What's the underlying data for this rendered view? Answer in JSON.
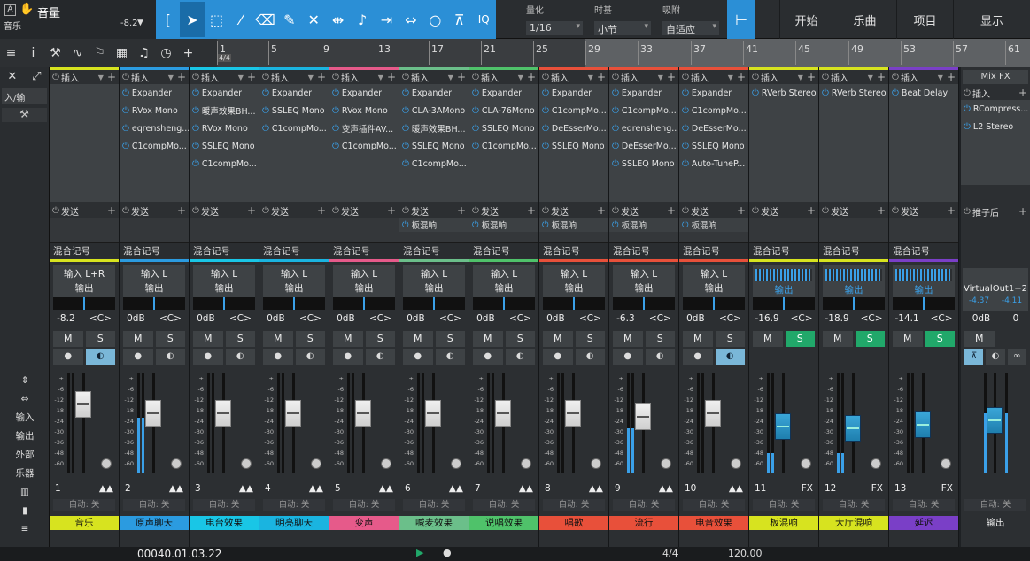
{
  "toolbar": {
    "track_icon": "A",
    "track_title": "音量",
    "track_sub": "音乐",
    "track_value": "-8.2",
    "quant_label": "量化",
    "quant_value": "1/16",
    "timebase_label": "时基",
    "timebase_value": "小节",
    "snap_label": "吸附",
    "snap_value": "自适应",
    "iq": "IQ",
    "nav": [
      "开始",
      "乐曲",
      "项目",
      "显示"
    ]
  },
  "ruler": {
    "time_sig": "4/4",
    "ticks": [
      "1",
      "5",
      "9",
      "13",
      "17",
      "21",
      "25",
      "29",
      "33",
      "37",
      "41",
      "45",
      "49",
      "53",
      "57",
      "61"
    ]
  },
  "sidebar": {
    "io_label": "入/输",
    "items": [
      "输入",
      "输出",
      "外部",
      "乐器"
    ]
  },
  "common": {
    "insert": "插入",
    "send": "发送",
    "mix": "混合记号",
    "output": "输出",
    "center": "<C>",
    "mute": "M",
    "solo": "S",
    "auto": "自动: 关",
    "fx": "FX"
  },
  "channels": [
    {
      "input": "输入 L+R",
      "vol": "-8.2",
      "num": "1",
      "name": "音乐",
      "color": "#d7e31f",
      "plugins": [],
      "sends": [],
      "level": 0.76,
      "meter": 0.0,
      "solo_on": false,
      "mon_on": true
    },
    {
      "input": "输入 L",
      "vol": "0dB",
      "num": "2",
      "name": "原声聊天",
      "color": "#2b9be0",
      "plugins": [
        "Expander",
        "RVox Mono",
        "eqrensheng...",
        "C1compMo..."
      ],
      "sends": [],
      "level": 0.64,
      "meter": 0.55,
      "solo_on": false,
      "mon_on": false
    },
    {
      "input": "输入 L",
      "vol": "0dB",
      "num": "3",
      "name": "电台效果",
      "color": "#19c6e6",
      "plugins": [
        "Expander",
        "暖声效果BH...",
        "RVox Mono",
        "SSLEQ Mono",
        "C1compMo..."
      ],
      "sends": [],
      "level": 0.64,
      "meter": 0.0,
      "solo_on": false,
      "mon_on": false
    },
    {
      "input": "输入 L",
      "vol": "0dB",
      "num": "4",
      "name": "明亮聊天",
      "color": "#1ab4e0",
      "plugins": [
        "Expander",
        "SSLEQ Mono",
        "C1compMo..."
      ],
      "sends": [],
      "level": 0.64,
      "meter": 0.0,
      "solo_on": false,
      "mon_on": false
    },
    {
      "input": "输入 L",
      "vol": "0dB",
      "num": "5",
      "name": "变声",
      "color": "#e65a8a",
      "plugins": [
        "Expander",
        "RVox Mono",
        "变声插件AV...",
        "C1compMo..."
      ],
      "sends": [],
      "level": 0.64,
      "meter": 0.0,
      "solo_on": false,
      "mon_on": false
    },
    {
      "input": "输入 L",
      "vol": "0dB",
      "num": "6",
      "name": "喊麦效果",
      "color": "#6bbf8a",
      "plugins": [
        "Expander",
        "CLA-3AMono",
        "暖声效果BH...",
        "SSLEQ Mono",
        "C1compMo..."
      ],
      "sends": [
        "板混响"
      ],
      "level": 0.64,
      "meter": 0.0,
      "solo_on": false,
      "mon_on": false
    },
    {
      "input": "输入 L",
      "vol": "0dB",
      "num": "7",
      "name": "说唱效果",
      "color": "#4fc26a",
      "plugins": [
        "Expander",
        "CLA-76Mono",
        "SSLEQ Mono",
        "C1compMo..."
      ],
      "sends": [
        "板混响"
      ],
      "level": 0.64,
      "meter": 0.0,
      "solo_on": false,
      "mon_on": false
    },
    {
      "input": "输入 L",
      "vol": "0dB",
      "num": "8",
      "name": "唱歌",
      "color": "#e8503a",
      "plugins": [
        "Expander",
        "C1compMo...",
        "DeEsserMo...",
        "SSLEQ Mono"
      ],
      "sends": [
        "板混响"
      ],
      "level": 0.64,
      "meter": 0.0,
      "solo_on": false,
      "mon_on": false
    },
    {
      "input": "输入 L",
      "vol": "-6.3",
      "num": "9",
      "name": "流行",
      "color": "#e8503a",
      "plugins": [
        "Expander",
        "C1compMo...",
        "eqrensheng...",
        "DeEsserMo...",
        "SSLEQ Mono"
      ],
      "sends": [
        "板混响"
      ],
      "level": 0.58,
      "meter": 0.45,
      "solo_on": false,
      "mon_on": false
    },
    {
      "input": "输入 L",
      "vol": "0dB",
      "num": "10",
      "name": "电音效果",
      "color": "#e8503a",
      "plugins": [
        "Expander",
        "C1compMo...",
        "DeEsserMo...",
        "SSLEQ Mono",
        "Auto-TuneP..."
      ],
      "sends": [
        "板混响"
      ],
      "level": 0.64,
      "meter": 0.0,
      "solo_on": false,
      "mon_on": true
    },
    {
      "input": "",
      "vol": "-16.9",
      "num": "11",
      "name": "板混响",
      "color": "#d7e31f",
      "plugins": [
        "RVerb Stereo"
      ],
      "sends": [],
      "level": 0.45,
      "meter": 0.2,
      "solo_on": true,
      "mon_on": false
    },
    {
      "input": "",
      "vol": "-18.9",
      "num": "12",
      "name": "大厅混响",
      "color": "#d7e31f",
      "plugins": [
        "RVerb Stereo"
      ],
      "sends": [],
      "level": 0.43,
      "meter": 0.2,
      "solo_on": true,
      "mon_on": false
    },
    {
      "input": "",
      "vol": "-14.1",
      "num": "13",
      "name": "延迟",
      "color": "#7a3fc7",
      "plugins": [
        "Beat Delay"
      ],
      "sends": [],
      "level": 0.47,
      "meter": 0.0,
      "solo_on": true,
      "mon_on": false
    }
  ],
  "fxbus": {
    "header": "Mix FX",
    "insert": "插入",
    "plugins": [
      "RCompress...",
      "L2 Stereo"
    ],
    "post": "推子后",
    "out_name": "VirtualOut1+2",
    "peak_l": "-4.37",
    "peak_r": "-4.11",
    "vol": "0dB",
    "pan": "0",
    "name": "输出",
    "level": 0.54,
    "meter": 0.6
  },
  "transport": {
    "time": "00040.01.03.22",
    "sig": "4/4",
    "tempo": "120.00"
  }
}
